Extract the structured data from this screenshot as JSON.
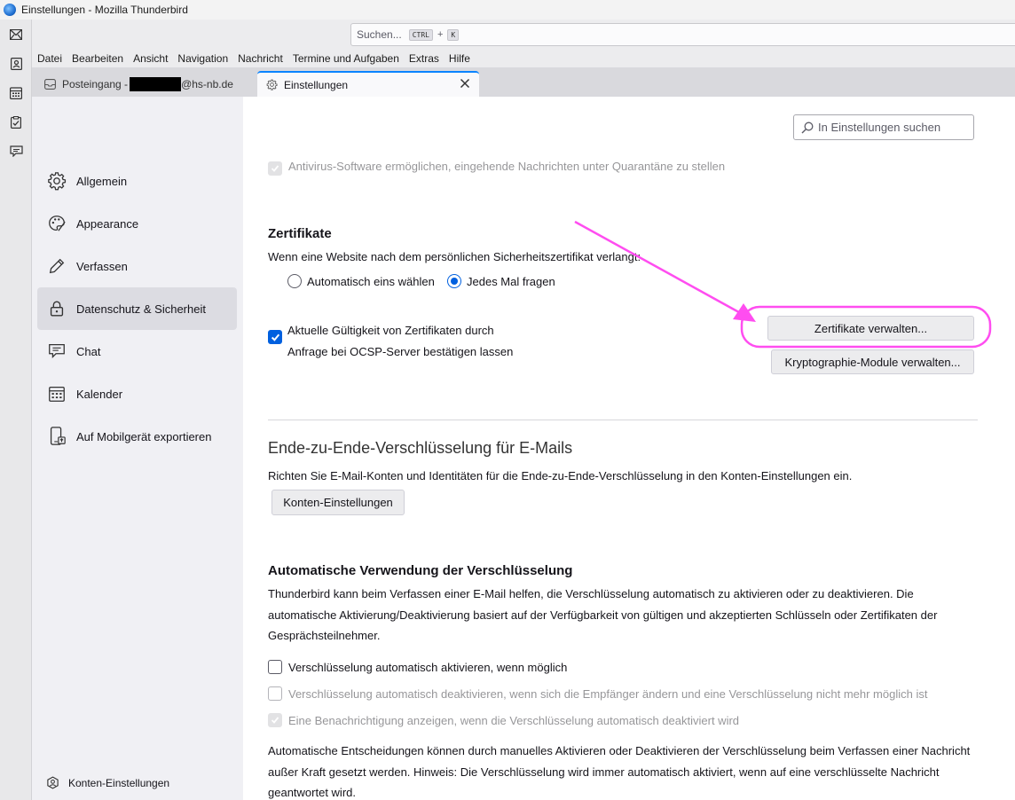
{
  "window": {
    "title": "Einstellungen - Mozilla Thunderbird"
  },
  "spaces": [
    {
      "icon": "mail-icon"
    },
    {
      "icon": "address-book-icon"
    },
    {
      "icon": "calendar-icon"
    },
    {
      "icon": "tasks-icon"
    },
    {
      "icon": "chat-icon"
    }
  ],
  "search": {
    "placeholder": "Suchen...",
    "key1": "CTRL",
    "plus": "+",
    "key2": "K"
  },
  "menu": [
    "Datei",
    "Bearbeiten",
    "Ansicht",
    "Navigation",
    "Nachricht",
    "Termine und Aufgaben",
    "Extras",
    "Hilfe"
  ],
  "tabs": {
    "inbox": {
      "prefix": "Posteingang - ",
      "suffix": "@hs-nb.de"
    },
    "settings": {
      "label": "Einstellungen"
    }
  },
  "categories": [
    {
      "label": "Allgemein",
      "icon": "gear-icon"
    },
    {
      "label": "Appearance",
      "icon": "palette-icon"
    },
    {
      "label": "Verfassen",
      "icon": "pencil-icon"
    },
    {
      "label": "Datenschutz & Sicherheit",
      "icon": "lock-icon",
      "selected": true
    },
    {
      "label": "Chat",
      "icon": "chat-icon"
    },
    {
      "label": "Kalender",
      "icon": "calendar-icon"
    },
    {
      "label": "Auf Mobilgerät exportieren",
      "icon": "mobile-export-icon"
    }
  ],
  "account_settings": {
    "label": "Konten-Einstellungen"
  },
  "pref_search": {
    "placeholder": "In Einstellungen suchen"
  },
  "antivirus": {
    "label": "Antivirus-Software ermöglichen, eingehende Nachrichten unter Quarantäne zu stellen",
    "checked": true,
    "disabled": true
  },
  "certificates": {
    "heading": "Zertifikate",
    "question": "Wenn eine Website nach dem persönlichen Sicherheitszertifikat verlangt:",
    "radio_auto": "Automatisch eins wählen",
    "radio_ask": "Jedes Mal fragen",
    "selected": "Jedes Mal fragen",
    "ocsp_line1": "Aktuelle Gültigkeit von Zertifikaten durch",
    "ocsp_line2": "Anfrage bei OCSP-Server bestätigen lassen",
    "ocsp_checked": true,
    "manage_btn": "Zertifikate verwalten...",
    "crypto_btn": "Kryptographie-Module verwalten..."
  },
  "e2e": {
    "heading": "Ende-zu-Ende-Verschlüsselung für E-Mails",
    "text": "Richten Sie E-Mail-Konten und Identitäten für die Ende-zu-Ende-Verschlüsselung in den Konten-Einstellungen ein.",
    "button": "Konten-Einstellungen"
  },
  "auto_encryption": {
    "heading": "Automatische Verwendung der Verschlüsselung",
    "line1": "Thunderbird kann beim Verfassen einer E-Mail helfen, die Verschlüsselung automatisch zu aktivieren oder zu deaktivieren. Die",
    "line2": "automatische Aktivierung/Deaktivierung basiert auf der Verfügbarkeit von gültigen und akzeptierten Schlüsseln oder Zertifikaten der",
    "line3": "Gesprächsteilnehmer.",
    "opt_enable": {
      "label": "Verschlüsselung automatisch aktivieren, wenn möglich",
      "checked": false
    },
    "opt_disable": {
      "label": "Verschlüsselung automatisch deaktivieren, wenn sich die Empfänger ändern und eine Verschlüsselung nicht mehr möglich ist",
      "checked": false,
      "disabled": true
    },
    "opt_notify": {
      "label": "Eine Benachrichtigung anzeigen, wenn die Verschlüsselung automatisch deaktiviert wird",
      "checked": true,
      "disabled": true
    },
    "note1": "Automatische Entscheidungen können durch manuelles Aktivieren oder Deaktivieren der Verschlüsselung beim Verfassen einer Nachricht",
    "note2": "außer Kraft gesetzt werden. Hinweis: Die Verschlüsselung wird immer automatisch aktiviert, wenn auf eine verschlüsselte Nachricht",
    "note3": "geantwortet wird."
  },
  "colors": {
    "accent": "#0060df",
    "annotation": "#ff4df0"
  }
}
